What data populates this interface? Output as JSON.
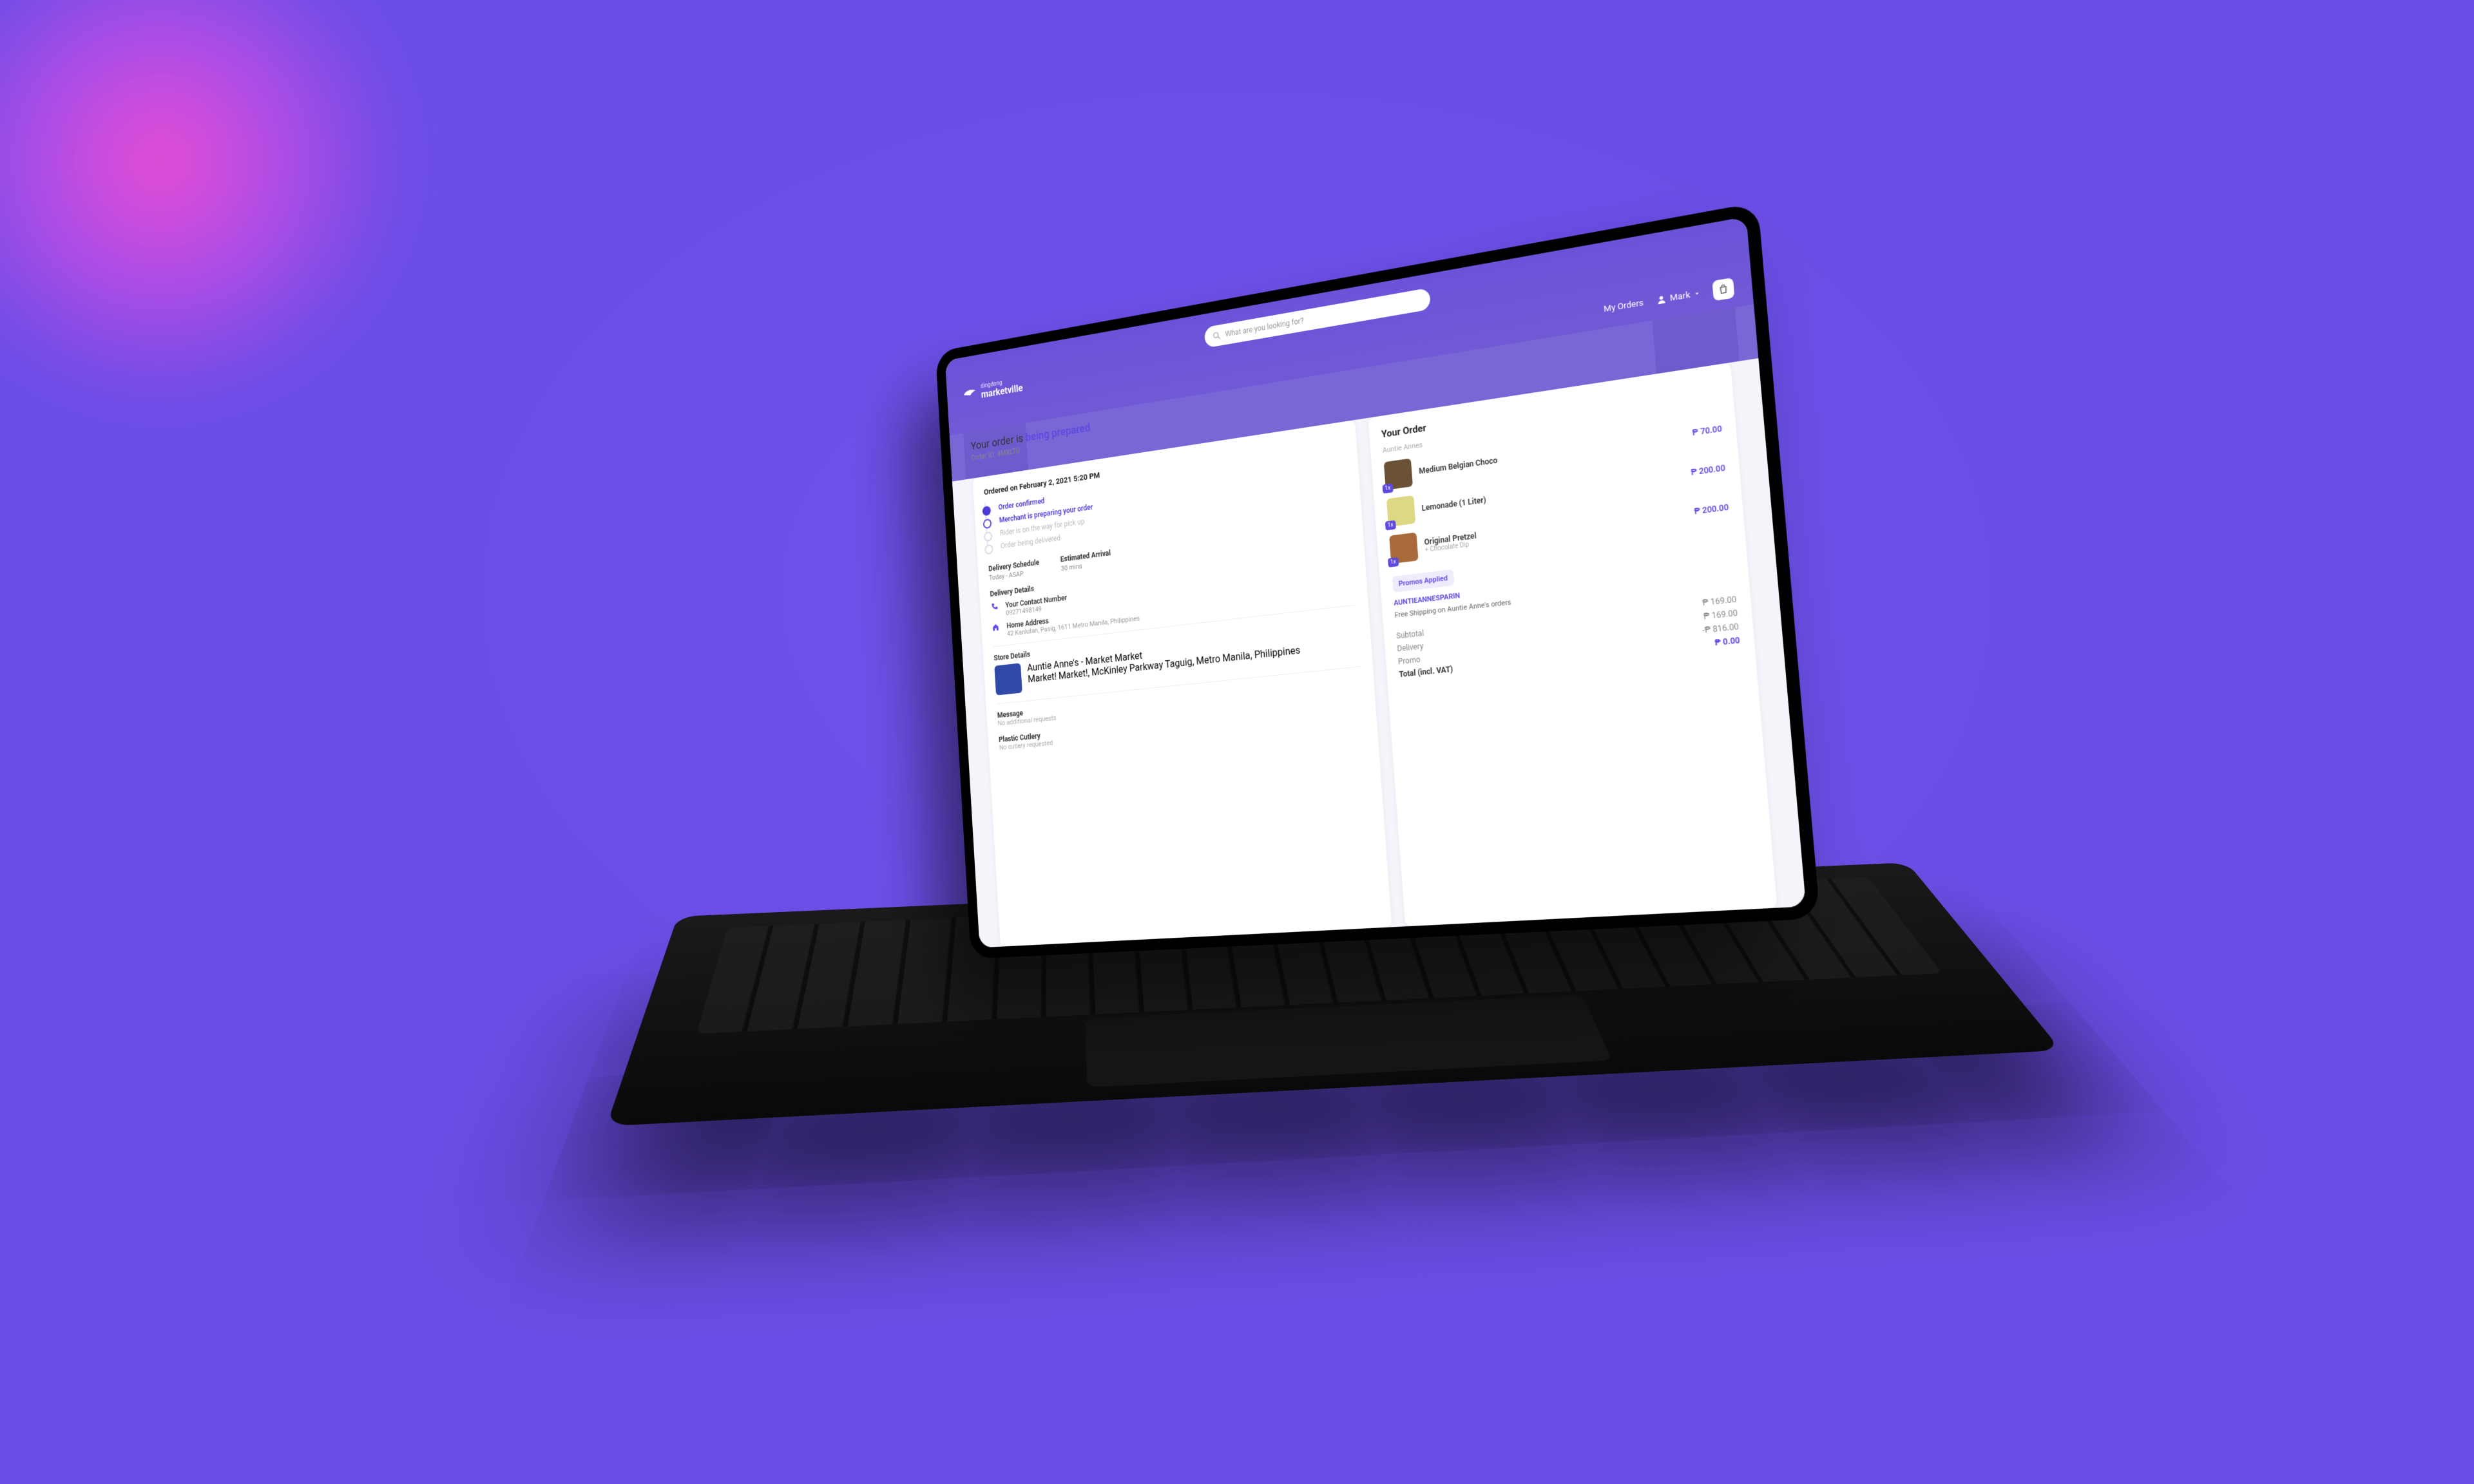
{
  "brand": {
    "top": "dingdong",
    "name": "marketville"
  },
  "search": {
    "placeholder": "What are you looking for?"
  },
  "nav": {
    "my_orders": "My Orders",
    "user_name": "Mark"
  },
  "page_title": {
    "prefix": "Your order is ",
    "status": "being prepared",
    "order_id_label": "Order ID: 4MXLT0"
  },
  "progress": {
    "ordered_on": "Ordered on February 2, 2021 5:20 PM",
    "steps": [
      {
        "label": "Order confirmed",
        "state": "done"
      },
      {
        "label": "Merchant is preparing your order",
        "state": "active"
      },
      {
        "label": "Rider is on the way for pick up",
        "state": "pending"
      },
      {
        "label": "Order being delivered",
        "state": "pending"
      }
    ]
  },
  "schedule": {
    "label": "Delivery Schedule",
    "value": "Today - ASAP",
    "eta_label": "Estimated Arrival",
    "eta_value": "30 mins"
  },
  "delivery": {
    "heading": "Delivery Details",
    "contact_label": "Your Contact Number",
    "contact_value": "09271498149",
    "address_label": "Home Address",
    "address_value": "42 Kanlutan, Pasig, 1611 Metro Manila, Philippines"
  },
  "store": {
    "heading": "Store Details",
    "name": "Auntie Anne's - Market Market",
    "address": "Market! Market!, McKinley Parkway Taguig, Metro Manila, Philippines"
  },
  "misc": {
    "message_label": "Message",
    "message_value": "No additional requests",
    "cutlery_label": "Plastic Cutlery",
    "cutlery_value": "No cutlery requested"
  },
  "order": {
    "heading": "Your Order",
    "store": "Auntie Annes",
    "items": [
      {
        "qty": "1x",
        "name": "Medium Belgian Choco",
        "sub": "",
        "price": "₱ 70.00",
        "color": "#6b5236"
      },
      {
        "qty": "1x",
        "name": "Lemonade (1 Liter)",
        "sub": "",
        "price": "₱ 200.00",
        "color": "#dcd884"
      },
      {
        "qty": "1x",
        "name": "Original Pretzel",
        "sub": "+ Chocolate Dip",
        "price": "₱ 200.00",
        "color": "#a86a3a"
      }
    ],
    "promos_label": "Promos Applied",
    "promo_code": "AUNTIEANNESPARIN",
    "promo_desc": "Free Shipping on Auntie Anne's orders",
    "totals": {
      "subtotal_label": "Subtotal",
      "subtotal": "₱ 169.00",
      "delivery_label": "Delivery",
      "delivery": "₱ 169.00",
      "promo_label": "Promo",
      "promo": "-₱ 816.00",
      "total_label": "Total (incl. VAT)",
      "total": "₱ 0.00"
    }
  }
}
